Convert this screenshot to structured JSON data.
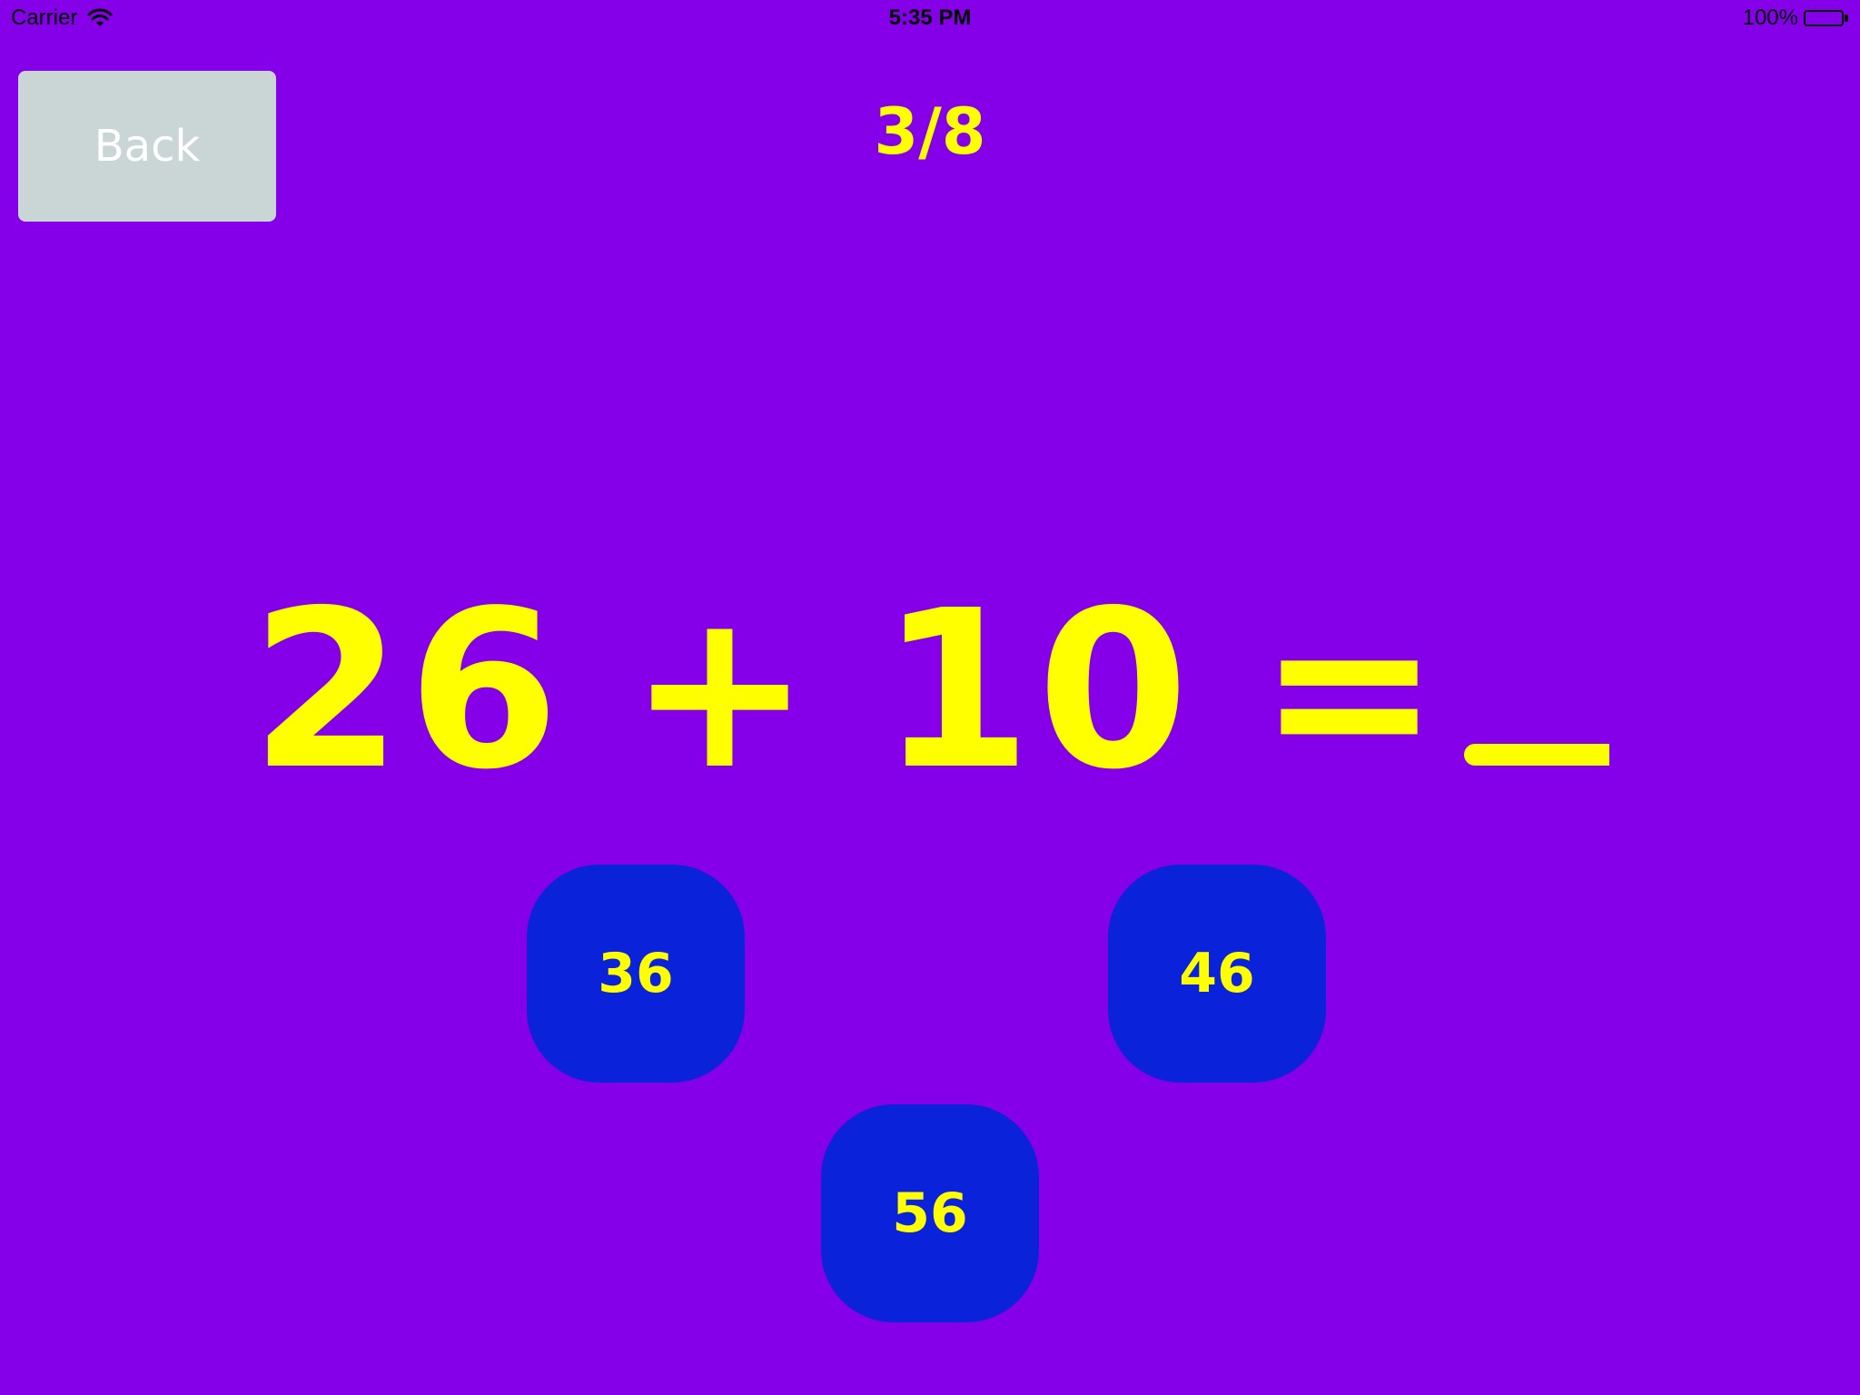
{
  "status_bar": {
    "carrier": "Carrier",
    "time": "5:35 PM",
    "battery": "100%"
  },
  "colors": {
    "background": "#8500E8",
    "text_accent": "#FFFF00",
    "back_button_bg": "#CAD6D6",
    "answer_button_bg": "#0A22DA"
  },
  "header": {
    "back_label": "Back",
    "progress": "3/8"
  },
  "question": {
    "operand_a": "26",
    "operator": "+",
    "operand_b": "10",
    "equals": "="
  },
  "answers": [
    {
      "label": "36"
    },
    {
      "label": "46"
    },
    {
      "label": "56"
    }
  ]
}
